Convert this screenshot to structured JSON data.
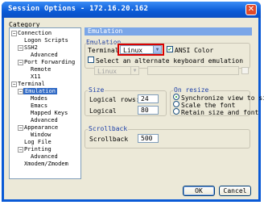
{
  "window": {
    "title": "Session Options - 172.16.20.162",
    "close_glyph": "✕"
  },
  "category": {
    "label": "Category",
    "tree": [
      {
        "label": "Connection",
        "expander": "−"
      },
      {
        "label": "Logon Scripts"
      },
      {
        "label": "SSH2",
        "expander": "−"
      },
      {
        "label": "Advanced"
      },
      {
        "label": "Port Forwarding",
        "expander": "−"
      },
      {
        "label": "Remote"
      },
      {
        "label": "X11"
      },
      {
        "label": "Terminal",
        "expander": "−"
      },
      {
        "label": "Emulation",
        "expander": "−",
        "selected": true
      },
      {
        "label": "Modes"
      },
      {
        "label": "Emacs"
      },
      {
        "label": "Mapped Keys"
      },
      {
        "label": "Advanced"
      },
      {
        "label": "Appearance",
        "expander": "−"
      },
      {
        "label": "Window"
      },
      {
        "label": "Log File"
      },
      {
        "label": "Printing",
        "expander": "−"
      },
      {
        "label": "Advanced"
      },
      {
        "label": "Xmodem/Zmodem"
      }
    ]
  },
  "panel": {
    "header": "Emulation",
    "emulation": {
      "group_title": "Emulation",
      "terminal_label": "Terminal",
      "terminal_value": "Linux",
      "ansi_color_label": "ANSI Color",
      "ansi_color_checked": true,
      "alt_keyboard_label": "Select an alternate keyboard emulation",
      "alt_keyboard_checked": false,
      "alt_keyboard_value": "Linux"
    },
    "size": {
      "group_title": "Size",
      "rows_label": "Logical rows:",
      "rows_value": "24",
      "cols_label": "Logical",
      "cols_value": "80"
    },
    "on_resize": {
      "group_title": "On resize",
      "options": [
        {
          "label": "Synchronize view to siz",
          "selected": true
        },
        {
          "label": "Scale the font",
          "selected": false
        },
        {
          "label": "Retain size and font",
          "selected": false
        }
      ]
    },
    "scrollback": {
      "group_title": "Scrollback",
      "label": "Scrollback",
      "value": "500"
    }
  },
  "buttons": {
    "ok": "OK",
    "cancel": "Cancel"
  },
  "colors": {
    "titlebar": "#0a5ad6",
    "panel_header": "#7aa6e8",
    "selection": "#316ac5",
    "highlight_box": "#d80000"
  }
}
